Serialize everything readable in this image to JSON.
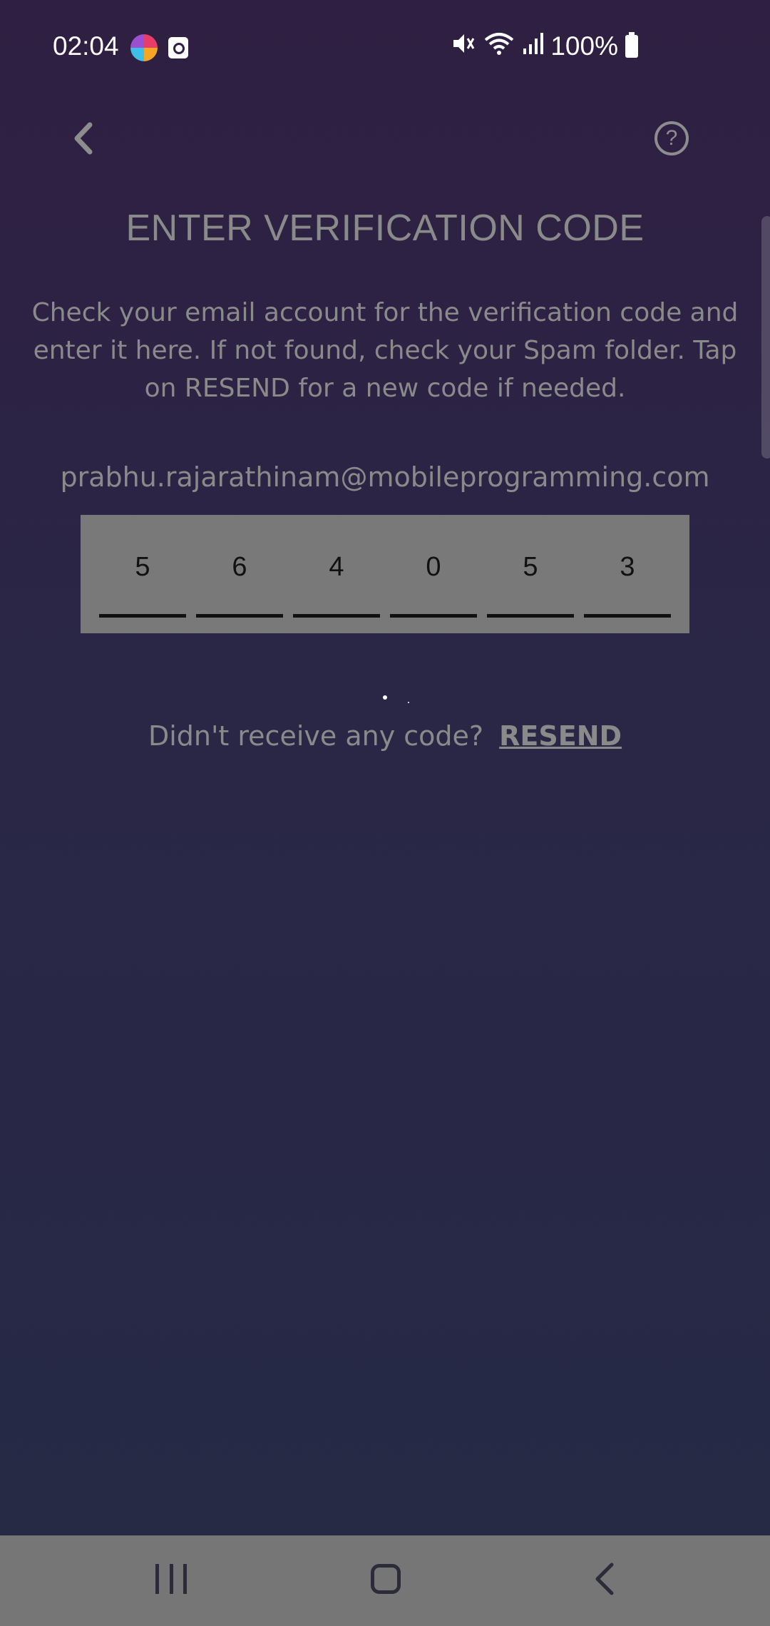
{
  "status_bar": {
    "time": "02:04",
    "battery": "100%",
    "icons": [
      "colorful-app-icon",
      "clock-app-icon",
      "mute-icon",
      "wifi-icon",
      "signal-icon",
      "battery-icon"
    ]
  },
  "header": {
    "back_icon": "chevron-left-icon",
    "help_icon": "question-circle-icon",
    "help_glyph": "?"
  },
  "main": {
    "title": "ENTER VERIFICATION CODE",
    "instructions": "Check your email account for the verification code and enter it here. If not found, check your Spam folder. Tap on RESEND for a new code if needed.",
    "email": "prabhu.rajarathinam@mobileprogramming.com",
    "code_digits": [
      "5",
      "6",
      "4",
      "0",
      "5",
      "3"
    ],
    "resend_prompt": "Didn't receive any code?",
    "resend_link": "RESEND"
  },
  "nav_bar": {
    "icons": [
      "recents-icon",
      "home-icon",
      "back-icon"
    ]
  },
  "colors": {
    "background_top": "#2f1f42",
    "background_bottom": "#252a45",
    "text_muted": "#8a8a8a",
    "code_box": "#797979",
    "nav_bar": "#767676"
  }
}
